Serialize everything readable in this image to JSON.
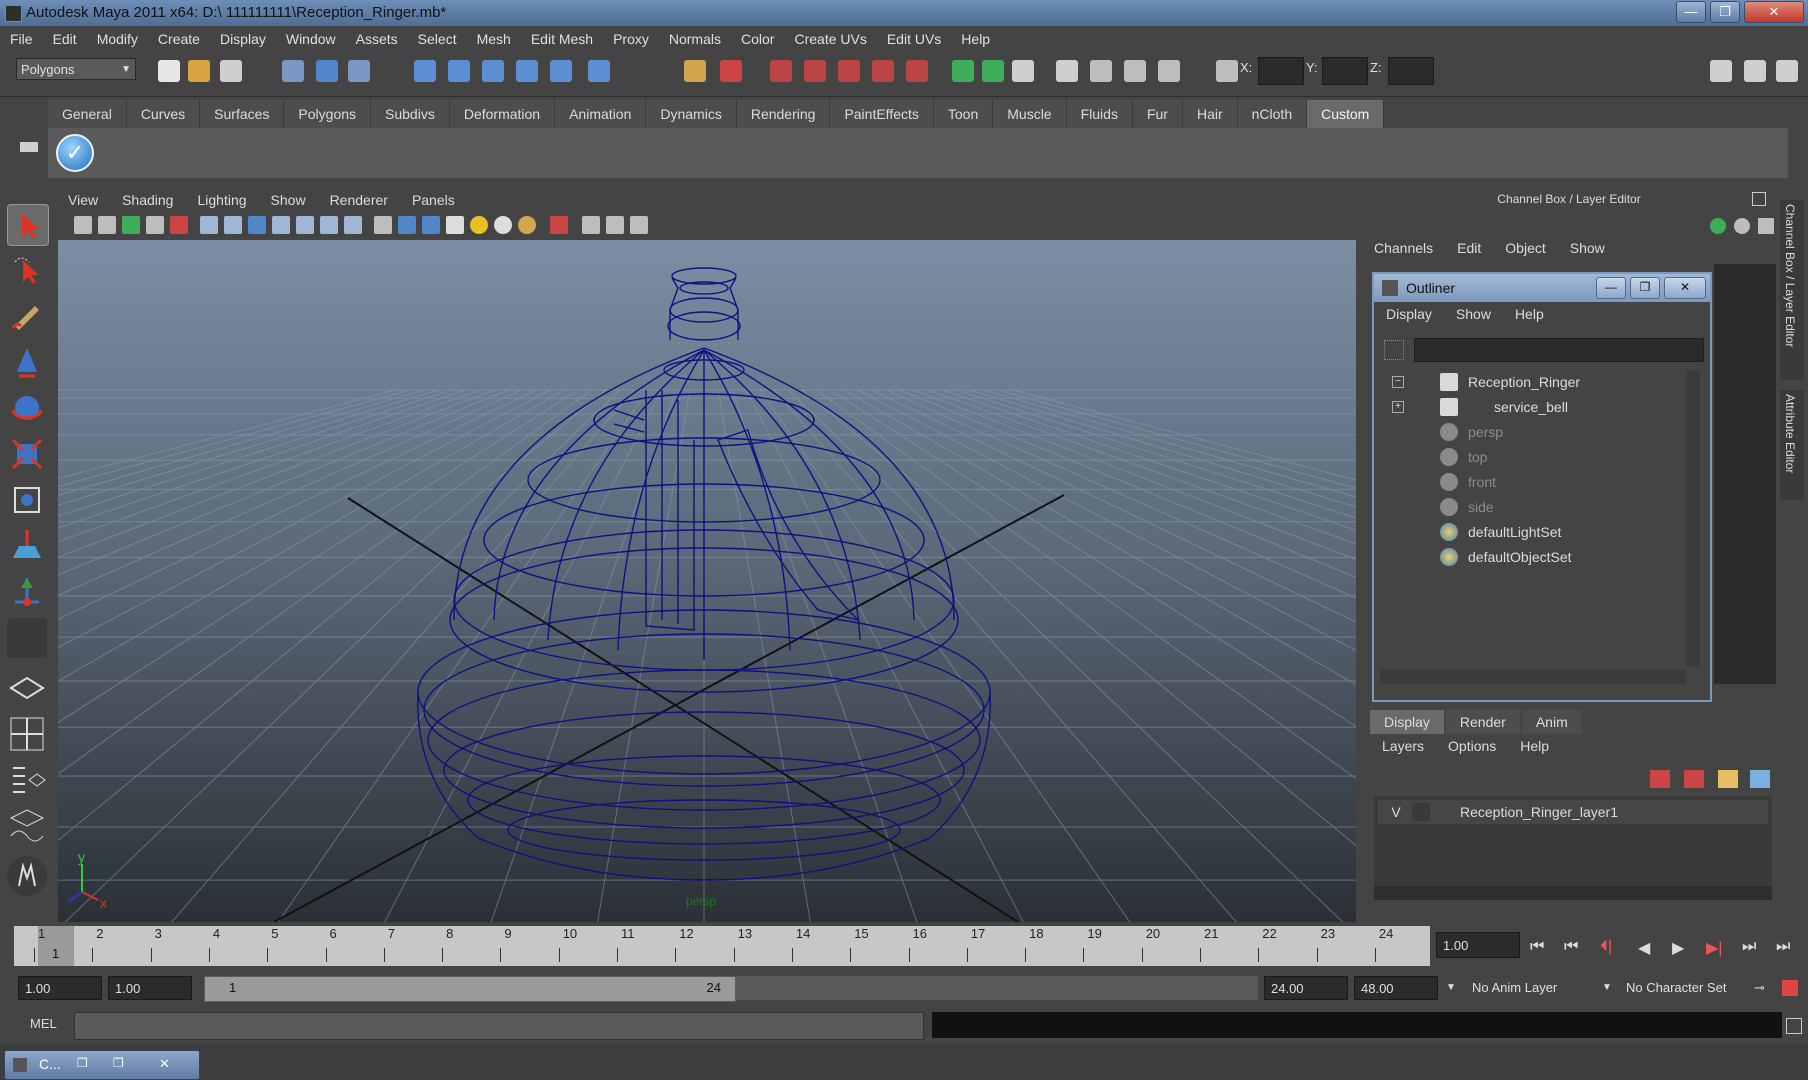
{
  "window": {
    "title": "Autodesk Maya 2011 x64: D:\\ 111111111\\Reception_Ringer.mb*",
    "minimize": "—",
    "maximize": "❐",
    "close": "✕"
  },
  "menubar": [
    "File",
    "Edit",
    "Modify",
    "Create",
    "Display",
    "Window",
    "Assets",
    "Select",
    "Mesh",
    "Edit Mesh",
    "Proxy",
    "Normals",
    "Color",
    "Create UVs",
    "Edit UVs",
    "Help"
  ],
  "statusline": {
    "menuset": "Polygons",
    "x_label": "X:",
    "y_label": "Y:",
    "z_label": "Z:"
  },
  "shelf": {
    "tabs": [
      "General",
      "Curves",
      "Surfaces",
      "Polygons",
      "Subdivs",
      "Deformation",
      "Animation",
      "Dynamics",
      "Rendering",
      "PaintEffects",
      "Toon",
      "Muscle",
      "Fluids",
      "Fur",
      "Hair",
      "nCloth",
      "Custom"
    ],
    "active_tab": "Custom",
    "check_icon": "✓"
  },
  "viewport": {
    "menu": [
      "View",
      "Shading",
      "Lighting",
      "Show",
      "Renderer",
      "Panels"
    ],
    "camera_label": "persp",
    "axis_x": "x",
    "axis_y": "y"
  },
  "channelbox": {
    "title": "Channel Box / Layer Editor",
    "menu": [
      "Channels",
      "Edit",
      "Object",
      "Show"
    ],
    "side_tab_1": "Channel Box / Layer Editor",
    "side_tab_2": "Attribute Editor"
  },
  "outliner": {
    "title": "Outliner",
    "menu": [
      "Display",
      "Show",
      "Help"
    ],
    "items": [
      {
        "label": "Reception_Ringer",
        "dim": false,
        "expander": "−"
      },
      {
        "label": "service_bell",
        "dim": false,
        "expander": "+"
      },
      {
        "label": "persp",
        "dim": true,
        "expander": ""
      },
      {
        "label": "top",
        "dim": true,
        "expander": ""
      },
      {
        "label": "front",
        "dim": true,
        "expander": ""
      },
      {
        "label": "side",
        "dim": true,
        "expander": ""
      },
      {
        "label": "defaultLightSet",
        "dim": false,
        "expander": ""
      },
      {
        "label": "defaultObjectSet",
        "dim": false,
        "expander": ""
      }
    ]
  },
  "layereditor": {
    "tabs": [
      "Display",
      "Render",
      "Anim"
    ],
    "active_tab": "Display",
    "menu": [
      "Layers",
      "Options",
      "Help"
    ],
    "layer": {
      "visibility": "V",
      "name": "Reception_Ringer_layer1"
    }
  },
  "timeline": {
    "ticks": [
      "1",
      "2",
      "3",
      "4",
      "5",
      "6",
      "7",
      "8",
      "9",
      "10",
      "11",
      "12",
      "13",
      "14",
      "15",
      "16",
      "17",
      "18",
      "19",
      "20",
      "21",
      "22",
      "23",
      "24"
    ],
    "current_frame_marker": "1",
    "current_time": "1.00",
    "playback_buttons": [
      "⏮",
      "⏮",
      "⏴|",
      "◀",
      "▶",
      "▶|",
      "⏭",
      "⏭"
    ]
  },
  "range": {
    "start_time": "1.00",
    "playback_start": "1.00",
    "slider_start": "1",
    "slider_end": "24",
    "playback_end": "24.00",
    "end_time": "48.00",
    "anim_layer": "No Anim Layer",
    "character_set": "No Character Set"
  },
  "commandline": {
    "label": "MEL"
  },
  "taskbar": {
    "mini_title": "C..."
  }
}
